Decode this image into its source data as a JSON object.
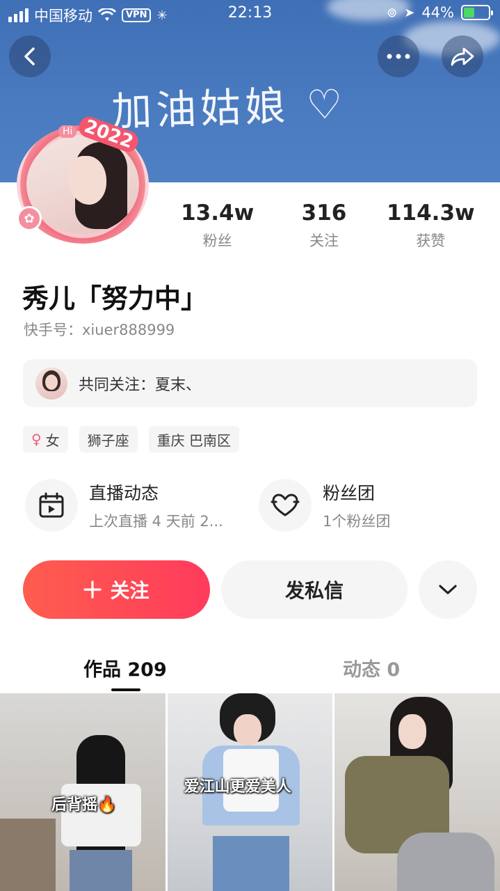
{
  "status_bar": {
    "carrier": "中国移动",
    "vpn": "VPN",
    "time": "22:13",
    "battery": "44%"
  },
  "banner": {
    "text": "加油姑娘 ♡"
  },
  "avatar": {
    "badge_hi": "Hi",
    "badge_year": "2022"
  },
  "stats": [
    {
      "value": "13.4w",
      "label": "粉丝"
    },
    {
      "value": "316",
      "label": "关注"
    },
    {
      "value": "114.3w",
      "label": "获赞"
    }
  ],
  "profile": {
    "name": "秀儿「努力中」",
    "uid": "快手号：xiuer888999"
  },
  "mutual_follow": {
    "text": "共同关注：夏末、"
  },
  "tags": {
    "gender": "女",
    "zodiac": "狮子座",
    "location": "重庆 巴南区"
  },
  "features": {
    "live": {
      "title": "直播动态",
      "subtitle": "上次直播 4 天前 2..."
    },
    "fan_group": {
      "title": "粉丝团",
      "subtitle": "1个粉丝团"
    }
  },
  "actions": {
    "follow": "关注",
    "message": "发私信"
  },
  "tabs": {
    "works": "作品 209",
    "moments": "动态 0"
  },
  "videos": [
    {
      "caption": "后背摇🔥"
    },
    {
      "caption": "爱江山更爱美人"
    },
    {
      "caption": ""
    }
  ],
  "colors": {
    "accent": "#ff3b5c",
    "banner": "#4a7bc0"
  }
}
